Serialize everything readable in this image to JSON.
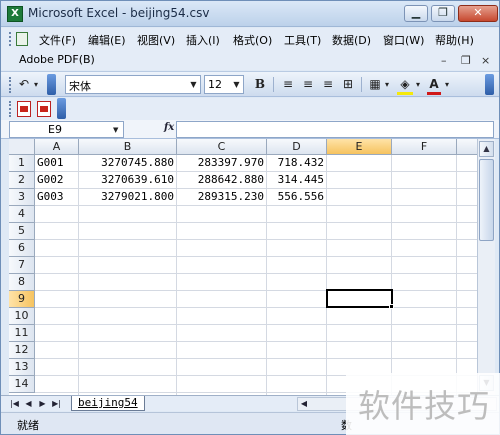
{
  "window": {
    "app_icon": "X",
    "title": "Microsoft Excel - beijing54.csv",
    "minimize_icon": "minimize-icon",
    "restore_icon": "restore-icon",
    "close_icon": "close-icon"
  },
  "menu": {
    "items": [
      "文件(F)",
      "编辑(E)",
      "视图(V)",
      "插入(I)",
      "格式(O)",
      "工具(T)",
      "数据(D)",
      "窗口(W)",
      "帮助(H)"
    ],
    "mdi_minimize": "–",
    "mdi_restore": "❐",
    "mdi_close": "×"
  },
  "adobe_bar": {
    "label": "Adobe PDF(B)"
  },
  "toolbar": {
    "undo_icon": "undo-icon",
    "font_name": "宋体",
    "font_size": "12",
    "bold": "B",
    "align_left_icon": "align-left-icon",
    "align_center_icon": "align-center-icon",
    "align_right_icon": "align-right-icon",
    "merge_center_icon": "merge-center-icon",
    "borders_icon": "borders-icon",
    "fill_color": "#f5e90a",
    "font_color_letter": "A",
    "font_color": "#d01818"
  },
  "pdf_toolbar": {
    "icons": [
      "convert-to-pdf-icon",
      "convert-and-email-icon"
    ]
  },
  "formula_bar": {
    "name_box": "E9",
    "fx_label": "fx",
    "formula": ""
  },
  "sheet": {
    "columns": [
      "A",
      "B",
      "C",
      "D",
      "E",
      "F"
    ],
    "selected_column": "E",
    "rows": [
      "1",
      "2",
      "3",
      "4",
      "5",
      "6",
      "7",
      "8",
      "9",
      "10",
      "11",
      "12",
      "13",
      "14"
    ],
    "selected_row": "9",
    "data": [
      [
        "G001",
        "3270745.880",
        "283397.970",
        "718.432"
      ],
      [
        "G002",
        "3270639.610",
        "288642.880",
        "314.445"
      ],
      [
        "G003",
        "3279021.800",
        "289315.230",
        "556.556"
      ]
    ],
    "active_cell": "E9"
  },
  "tabs": {
    "sheet_name": "beijing54"
  },
  "status": {
    "text": "就绪",
    "right_text": "数"
  },
  "watermark": {
    "text": "软件技巧"
  }
}
